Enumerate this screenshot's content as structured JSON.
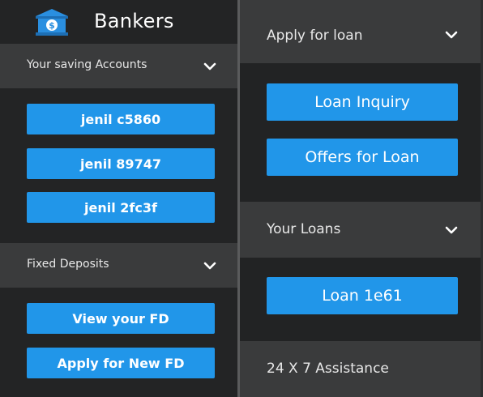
{
  "brand": {
    "title": "Bankers",
    "logo_icon": "bank-icon",
    "logo_symbol": "$"
  },
  "left": {
    "savings_header": "Your saving Accounts",
    "accounts": [
      "jenil c5860",
      "jenil 89747",
      "jenil 2fc3f"
    ],
    "fd_header": "Fixed Deposits",
    "fd_buttons": [
      "View your FD",
      "Apply for New FD"
    ]
  },
  "right": {
    "loan_header": "Apply for loan",
    "loan_buttons": [
      "Loan Inquiry",
      "Offers for Loan"
    ],
    "your_loans_header": "Your Loans",
    "loans": [
      "Loan 1e61"
    ],
    "assistance": "24 X 7 Assistance"
  },
  "colors": {
    "accent": "#2196e9",
    "panel": "#232425",
    "header": "#3a3b3c",
    "text": "#e8e8e8",
    "logo_blue": "#2a8fe0"
  }
}
